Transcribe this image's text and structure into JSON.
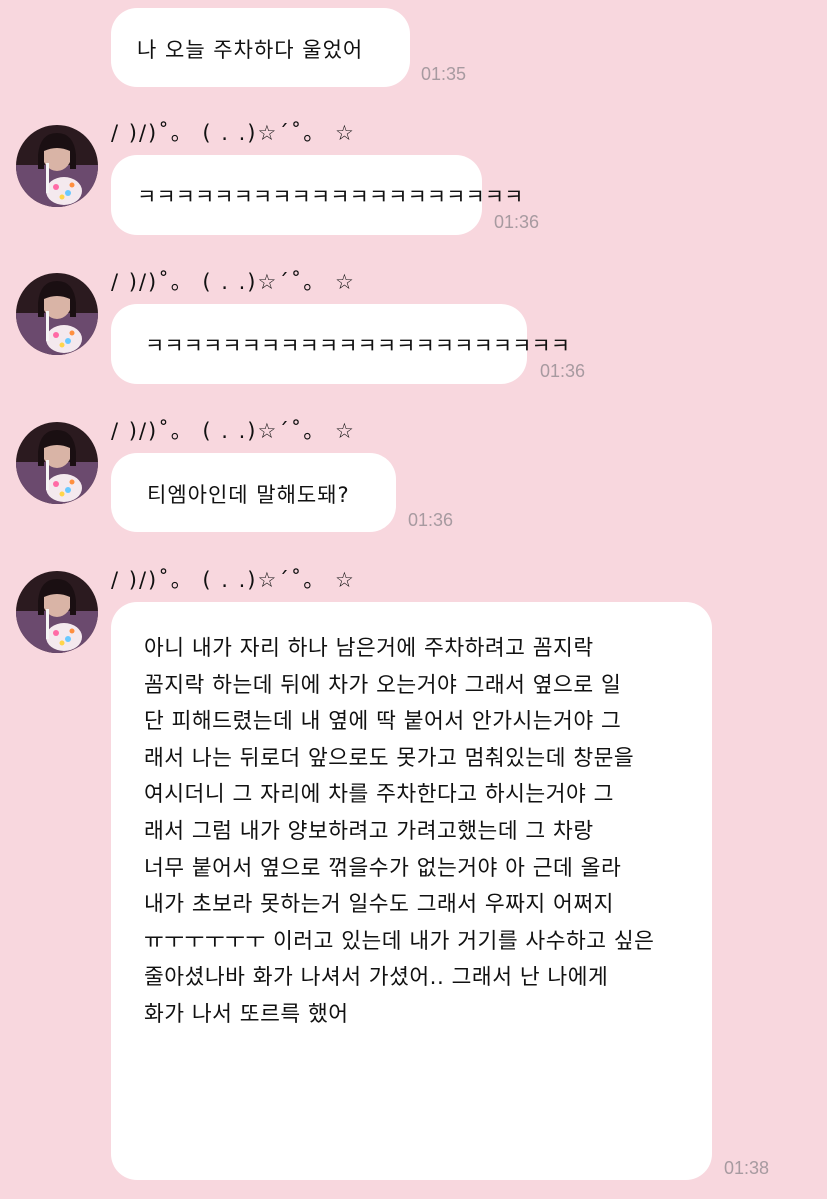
{
  "messages": [
    {
      "text": "나 오늘 주차하다 울었어",
      "time": "01:35"
    },
    {
      "sender": "/ )/)˚。 ( . .)☆´˚。 ☆",
      "text": "ㅋㅋㅋㅋㅋㅋㅋㅋㅋㅋㅋㅋㅋㅋㅋㅋㅋㅋㅋㅋ",
      "time": "01:36"
    },
    {
      "sender": "/ )/)˚。 ( . .)☆´˚。 ☆",
      "text": "ㅋㅋㅋㅋㅋㅋㅋㅋㅋㅋㅋㅋㅋㅋㅋㅋㅋㅋㅋㅋㅋㅋ",
      "time": "01:36"
    },
    {
      "sender": "/ )/)˚。 ( . .)☆´˚。 ☆",
      "text": "티엠아인데 말해도돼?",
      "time": "01:36"
    },
    {
      "sender": "/ )/)˚。 ( . .)☆´˚。 ☆",
      "text": "아니 내가 자리 하나 남은거에 주차하려고 꼼지락\n꼼지락 하는데 뒤에 차가 오는거야 그래서 옆으로 일\n단 피해드렸는데 내 옆에 딱 붙어서 안가시는거야 그\n래서 나는 뒤로더 앞으로도 못가고 멈춰있는데 창문을\n여시더니 그 자리에 차를 주차한다고 하시는거야 그\n래서 그럼 내가 양보하려고 가려고했는데 그 차랑\n너무 붙어서 옆으로 꺾을수가 없는거야 아 근데 올라\n내가 초보라 못하는거 일수도 그래서 우짜지 어쩌지\nㅠㅜㅜㅜㅜㅜ 이러고 있는데 내가 거기를 사수하고 싶은\n줄아셨나바 화가 나셔서 가셨어.. 그래서 난 나에게\n화가 나서 또르륵 했어",
      "time": "01:38"
    }
  ],
  "colors": {
    "background": "#f8d7de",
    "bubble": "#ffffff",
    "timestamp": "#a79aa0"
  },
  "icons": {
    "avatar": "profile-photo-avatar"
  }
}
